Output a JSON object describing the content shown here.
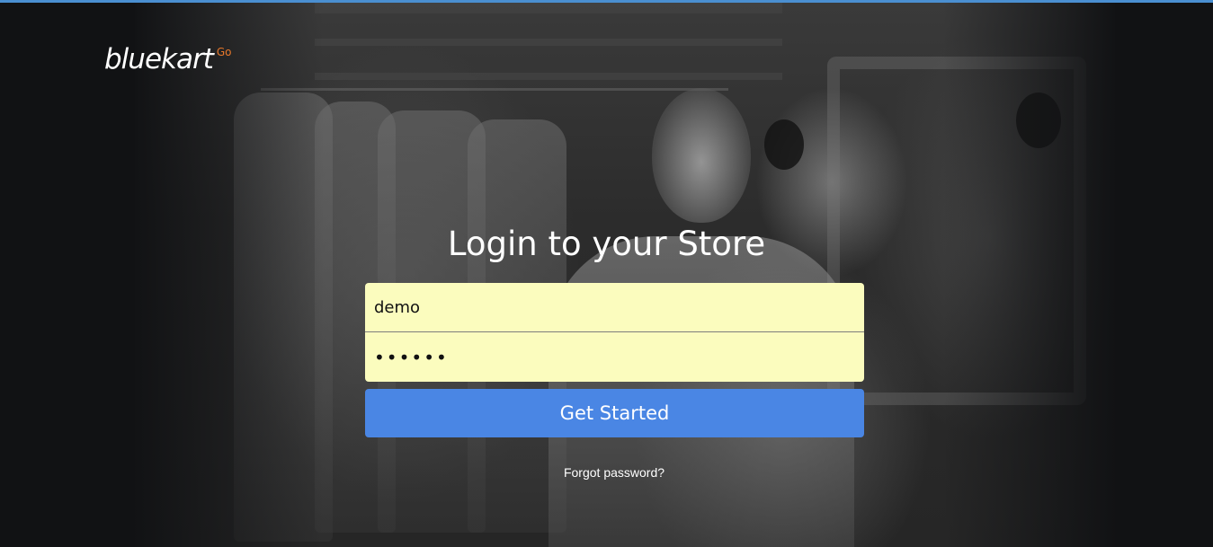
{
  "top_strip_color": "#4a8fd1",
  "brand": {
    "name": "bluekart",
    "suffix": "Go",
    "suffix_color": "#e8782a"
  },
  "login": {
    "title": "Login to your Store",
    "username_value": "demo",
    "password_value": "••••••",
    "submit_label": "Get Started",
    "forgot_label": "Forgot password?",
    "field_bg_color": "#fbfcbe",
    "button_color": "#4a86e4"
  },
  "background": {
    "description_icon": "store-photo-background"
  }
}
